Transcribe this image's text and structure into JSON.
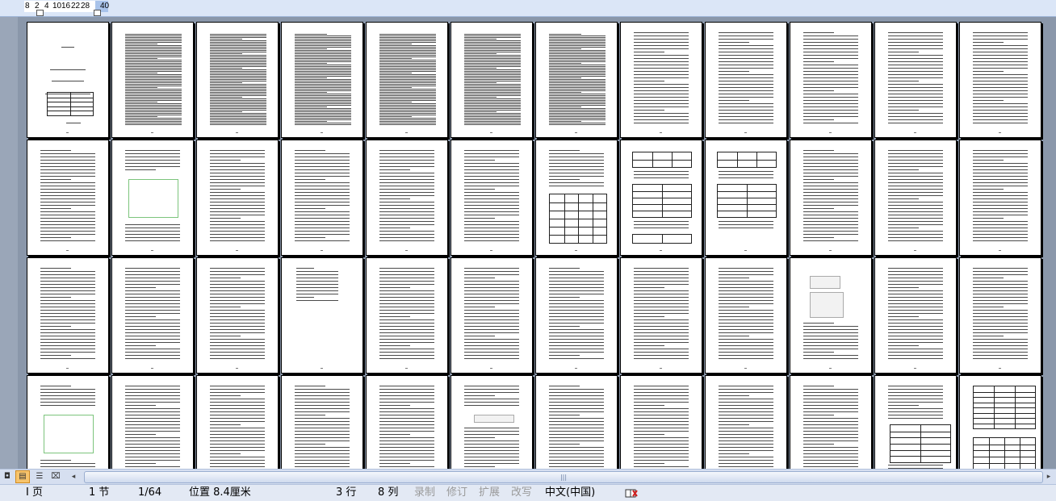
{
  "ruler": {
    "numbers": [
      "8",
      "2",
      "4",
      "10",
      "16",
      "22",
      "28",
      "40"
    ]
  },
  "view_buttons": [
    {
      "name": "normal-view-button",
      "glyph": "◘"
    },
    {
      "name": "print-layout-view-button",
      "glyph": "▤"
    },
    {
      "name": "outline-view-button",
      "glyph": "☰"
    },
    {
      "name": "reading-view-button",
      "glyph": "⌧"
    }
  ],
  "scrollbar": {
    "left_arrow": "◂",
    "right_arrow": "▸",
    "grip": "|||"
  },
  "status": {
    "page_label": "I 页",
    "section": "1 节",
    "page_count": "1/64",
    "position": "位置 8.4厘米",
    "line": "3 行",
    "column": "8 列",
    "rec": "录制",
    "track": "修订",
    "ext": "扩展",
    "ovr": "改写",
    "language": "中文(中国)"
  },
  "colors": {
    "workspace": "#8a97aa",
    "accent": "#f7c46c",
    "figure": "#7cc47c"
  }
}
